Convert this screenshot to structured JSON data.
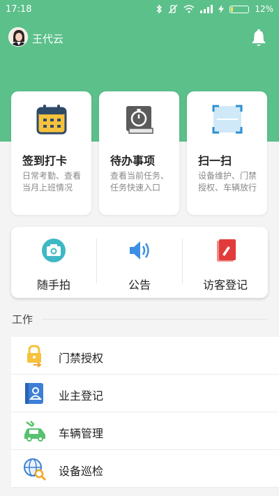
{
  "status_bar": {
    "time": "17:18",
    "battery_percent": "12%",
    "battery_level": 0.12
  },
  "header": {
    "username": "王代云"
  },
  "cards": [
    {
      "title": "签到打卡",
      "desc": "日常考勤、查看当月上班情况",
      "icon": "calendar-icon"
    },
    {
      "title": "待办事项",
      "desc": "查看当前任务、任务快速入口",
      "icon": "stopwatch-book-icon"
    },
    {
      "title": "扫一扫",
      "desc": "设备维护、门禁授权、车辆放行",
      "icon": "scan-icon"
    }
  ],
  "quick_actions": [
    {
      "label": "随手拍",
      "icon": "camera-icon"
    },
    {
      "label": "公告",
      "icon": "speaker-icon"
    },
    {
      "label": "访客登记",
      "icon": "visitor-register-icon"
    }
  ],
  "work_section": {
    "title": "工作",
    "items": [
      {
        "label": "门禁授权",
        "icon": "lock-icon"
      },
      {
        "label": "业主登记",
        "icon": "contact-book-icon"
      },
      {
        "label": "车辆管理",
        "icon": "car-wrench-icon"
      },
      {
        "label": "设备巡检",
        "icon": "globe-search-icon"
      }
    ]
  },
  "colors": {
    "brand_green": "#5cc08a",
    "accent_orange": "#f6c23d"
  }
}
